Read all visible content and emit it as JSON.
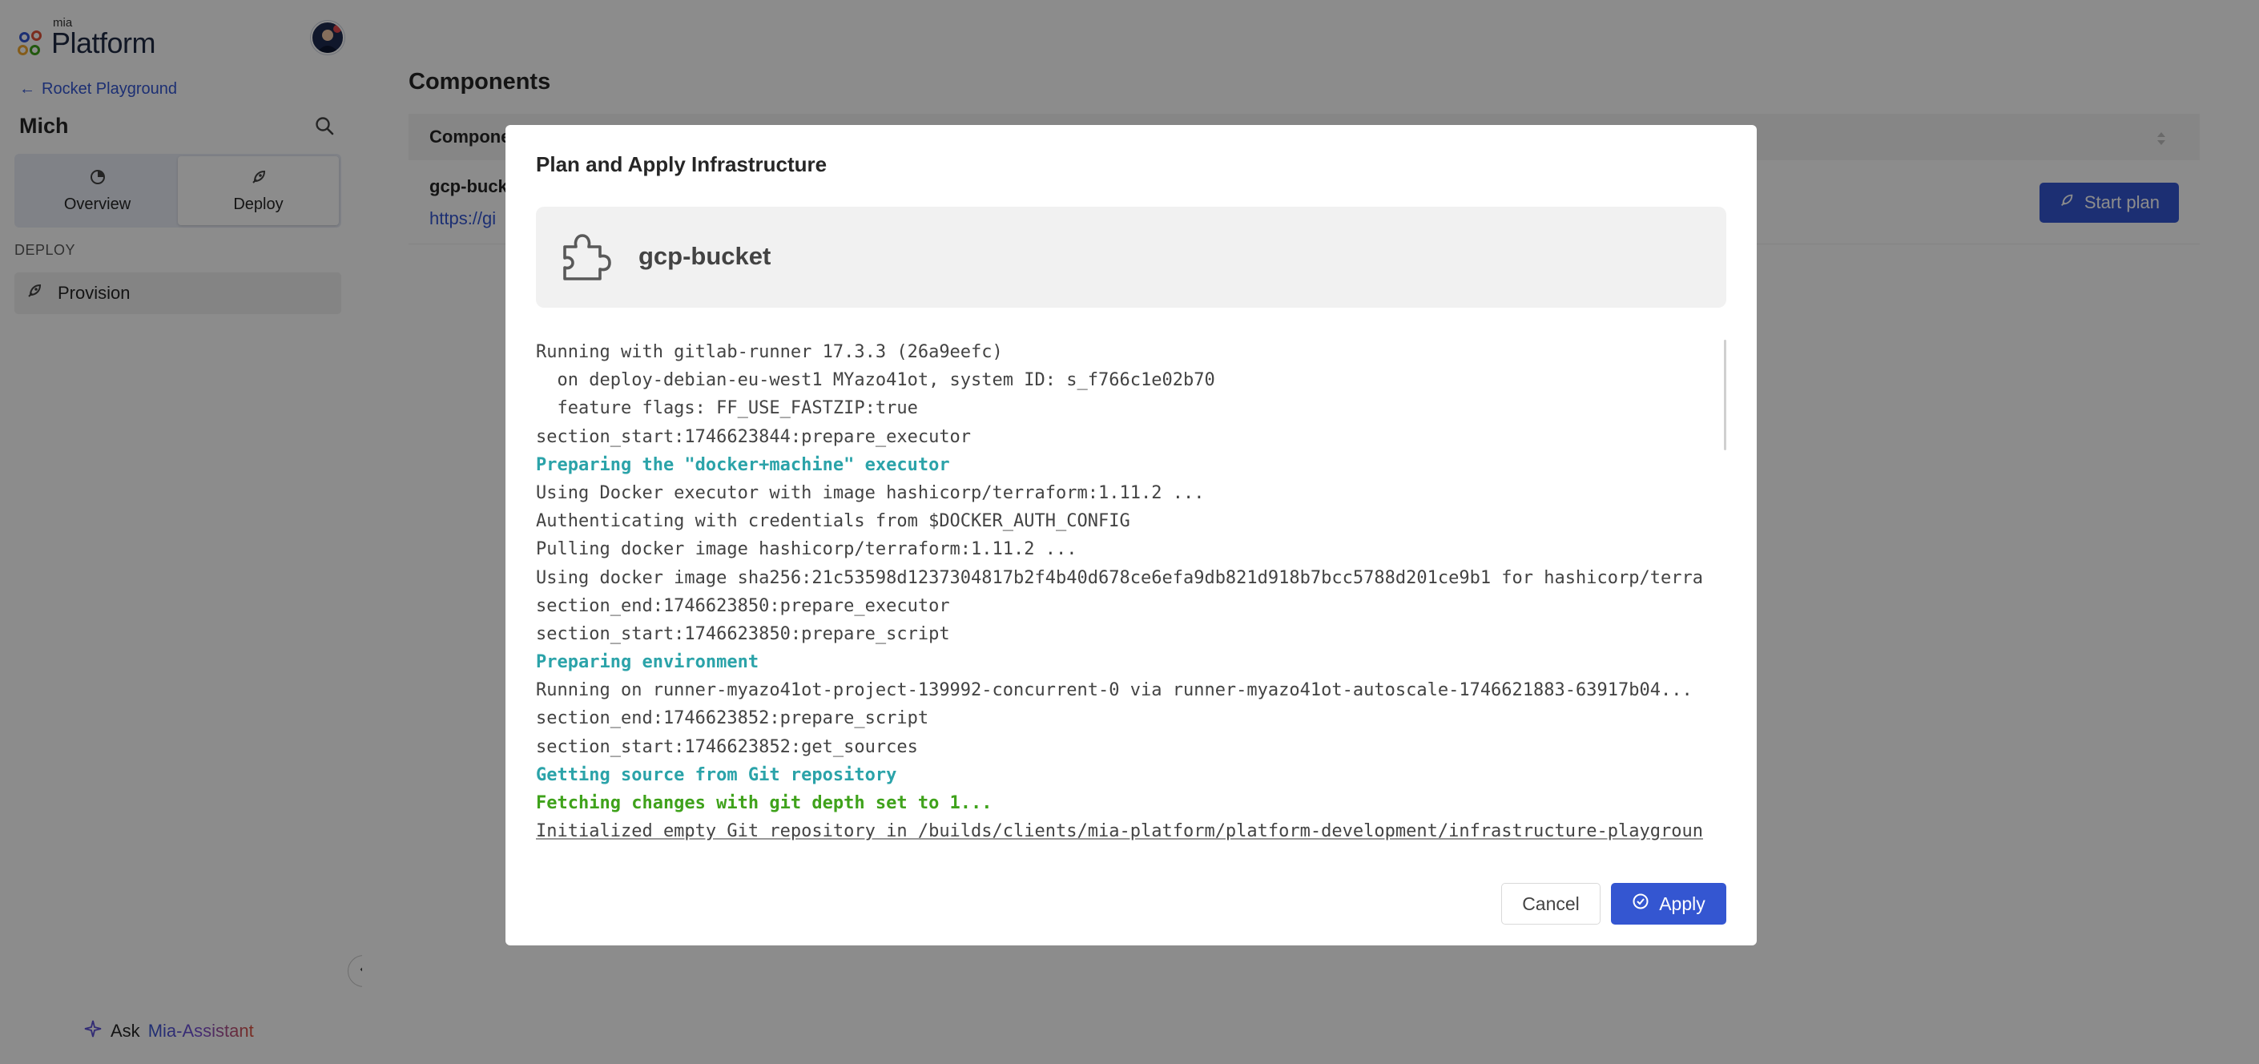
{
  "sidebar": {
    "logo": {
      "small": "mia",
      "big": "Platform"
    },
    "back_link": "Rocket Playground",
    "project_name": "Mich",
    "tabs": [
      {
        "label": "Overview",
        "icon": "overview-icon"
      },
      {
        "label": "Deploy",
        "icon": "rocket-icon",
        "active": true
      }
    ],
    "section_label": "DEPLOY",
    "nav_items": [
      {
        "label": "Provision",
        "icon": "rocket-icon"
      }
    ],
    "assistant": {
      "prefix": "Ask",
      "name": "Mia-Assistant"
    }
  },
  "main": {
    "title": "Components",
    "table": {
      "column_header": "Compone",
      "rows": [
        {
          "name": "gcp-buck",
          "link": "https://gi",
          "action_label": "Start plan"
        }
      ]
    }
  },
  "modal": {
    "title": "Plan and Apply Infrastructure",
    "resource_name": "gcp-bucket",
    "log_lines": [
      {
        "text": "Running with gitlab-runner 17.3.3 (26a9eefc)",
        "style": ""
      },
      {
        "text": "  on deploy-debian-eu-west1 MYazo41ot, system ID: s_f766c1e02b70",
        "style": ""
      },
      {
        "text": "  feature flags: FF_USE_FASTZIP:true",
        "style": ""
      },
      {
        "text": "section_start:1746623844:prepare_executor",
        "style": ""
      },
      {
        "text": "Preparing the \"docker+machine\" executor",
        "style": "cyan"
      },
      {
        "text": "Using Docker executor with image hashicorp/terraform:1.11.2 ...",
        "style": ""
      },
      {
        "text": "Authenticating with credentials from $DOCKER_AUTH_CONFIG",
        "style": ""
      },
      {
        "text": "Pulling docker image hashicorp/terraform:1.11.2 ...",
        "style": ""
      },
      {
        "text": "Using docker image sha256:21c53598d1237304817b2f4b40d678ce6efa9db821d918b7bcc5788d201ce9b1 for hashicorp/terra",
        "style": ""
      },
      {
        "text": "section_end:1746623850:prepare_executor",
        "style": ""
      },
      {
        "text": "section_start:1746623850:prepare_script",
        "style": ""
      },
      {
        "text": "Preparing environment",
        "style": "cyan"
      },
      {
        "text": "Running on runner-myazo41ot-project-139992-concurrent-0 via runner-myazo41ot-autoscale-1746621883-63917b04...",
        "style": ""
      },
      {
        "text": "section_end:1746623852:prepare_script",
        "style": ""
      },
      {
        "text": "section_start:1746623852:get_sources",
        "style": ""
      },
      {
        "text": "Getting source from Git repository",
        "style": "cyan"
      },
      {
        "text": "Fetching changes with git depth set to 1...",
        "style": "green"
      },
      {
        "text": "Initialized empty Git repository in /builds/clients/mia-platform/platform-development/infrastructure-playgroun",
        "style": "ul"
      }
    ],
    "cancel_label": "Cancel",
    "apply_label": "Apply"
  },
  "colors": {
    "primary": "#3456d1",
    "log_cyan": "#2ba3a9",
    "log_green": "#3fa21b",
    "overlay": "rgba(0,0,0,0.45)"
  }
}
